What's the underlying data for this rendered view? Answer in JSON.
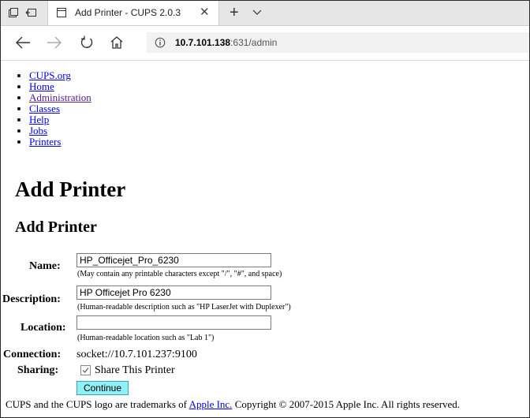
{
  "browser": {
    "tab_title": "Add Printer - CUPS 2.0.3",
    "tab_close": "✕",
    "new_tab": "+",
    "url_host": "10.7.101.138",
    "url_rest": ":631/admin"
  },
  "nav": {
    "items": [
      {
        "label": "CUPS.org"
      },
      {
        "label": "Home"
      },
      {
        "label": "Administration"
      },
      {
        "label": "Classes"
      },
      {
        "label": "Help"
      },
      {
        "label": "Jobs"
      },
      {
        "label": "Printers"
      }
    ]
  },
  "page": {
    "title": "Add Printer",
    "subtitle": "Add Printer"
  },
  "form": {
    "name_label": "Name:",
    "name_value": "HP_Officejet_Pro_6230",
    "name_hint": "(May contain any printable characters except \"/\", \"#\", and space)",
    "description_label": "Description:",
    "description_value": "HP Officejet Pro 6230",
    "description_hint": "(Human-readable description such as \"HP LaserJet with Duplexer\")",
    "location_label": "Location:",
    "location_value": "",
    "location_hint": "(Human-readable location such as \"Lab 1\")",
    "connection_label": "Connection:",
    "connection_value": "socket://10.7.101.237:9100",
    "sharing_label": "Sharing:",
    "share_checked": true,
    "share_text": "Share This Printer",
    "continue_label": "Continue"
  },
  "footer": {
    "prefix": "CUPS and the CUPS logo are trademarks of",
    "link": "Apple Inc.",
    "suffix": "Copyright © 2007-2015 Apple Inc. All rights reserved."
  },
  "colors": {
    "link": "#0000ee",
    "visited_link": "#551a8b",
    "button_bg": "#8ff0f5"
  }
}
